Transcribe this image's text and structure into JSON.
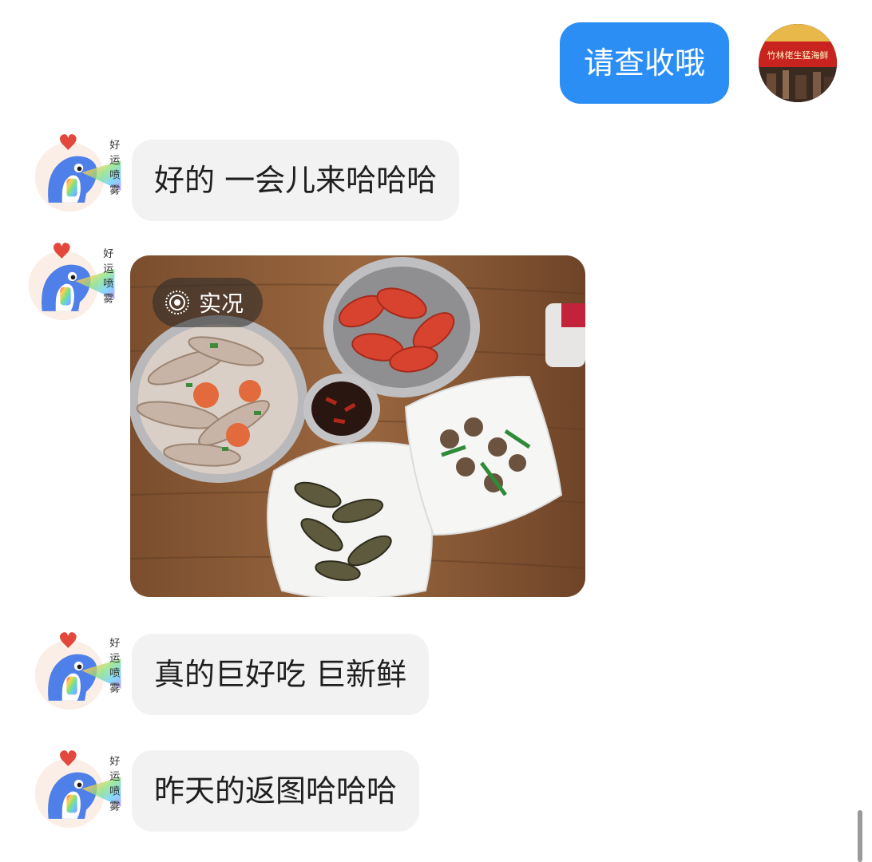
{
  "messages": {
    "outgoing": {
      "text": "请查收哦",
      "bubble_color": "#2b8ef5"
    },
    "incoming": [
      {
        "text": "好的 一会儿来哈哈哈"
      },
      {
        "type": "photo",
        "badge_label": "实况",
        "content": "seafood-dishes-on-wooden-table"
      },
      {
        "text": "真的巨好吃 巨新鲜"
      },
      {
        "text": "昨天的返图哈哈哈"
      }
    ]
  },
  "contact_avatar": {
    "sticker_text": "好运喷雾",
    "icon": "dolphin-sticker-avatar"
  },
  "self_avatar": {
    "sign_text": "竹林佬生猛海鲜",
    "icon": "storefront-photo-avatar"
  },
  "colors": {
    "incoming_bubble": "#f2f2f2",
    "incoming_text": "#1f1f1f",
    "outgoing_text": "#ffffff",
    "background": "#ffffff"
  }
}
